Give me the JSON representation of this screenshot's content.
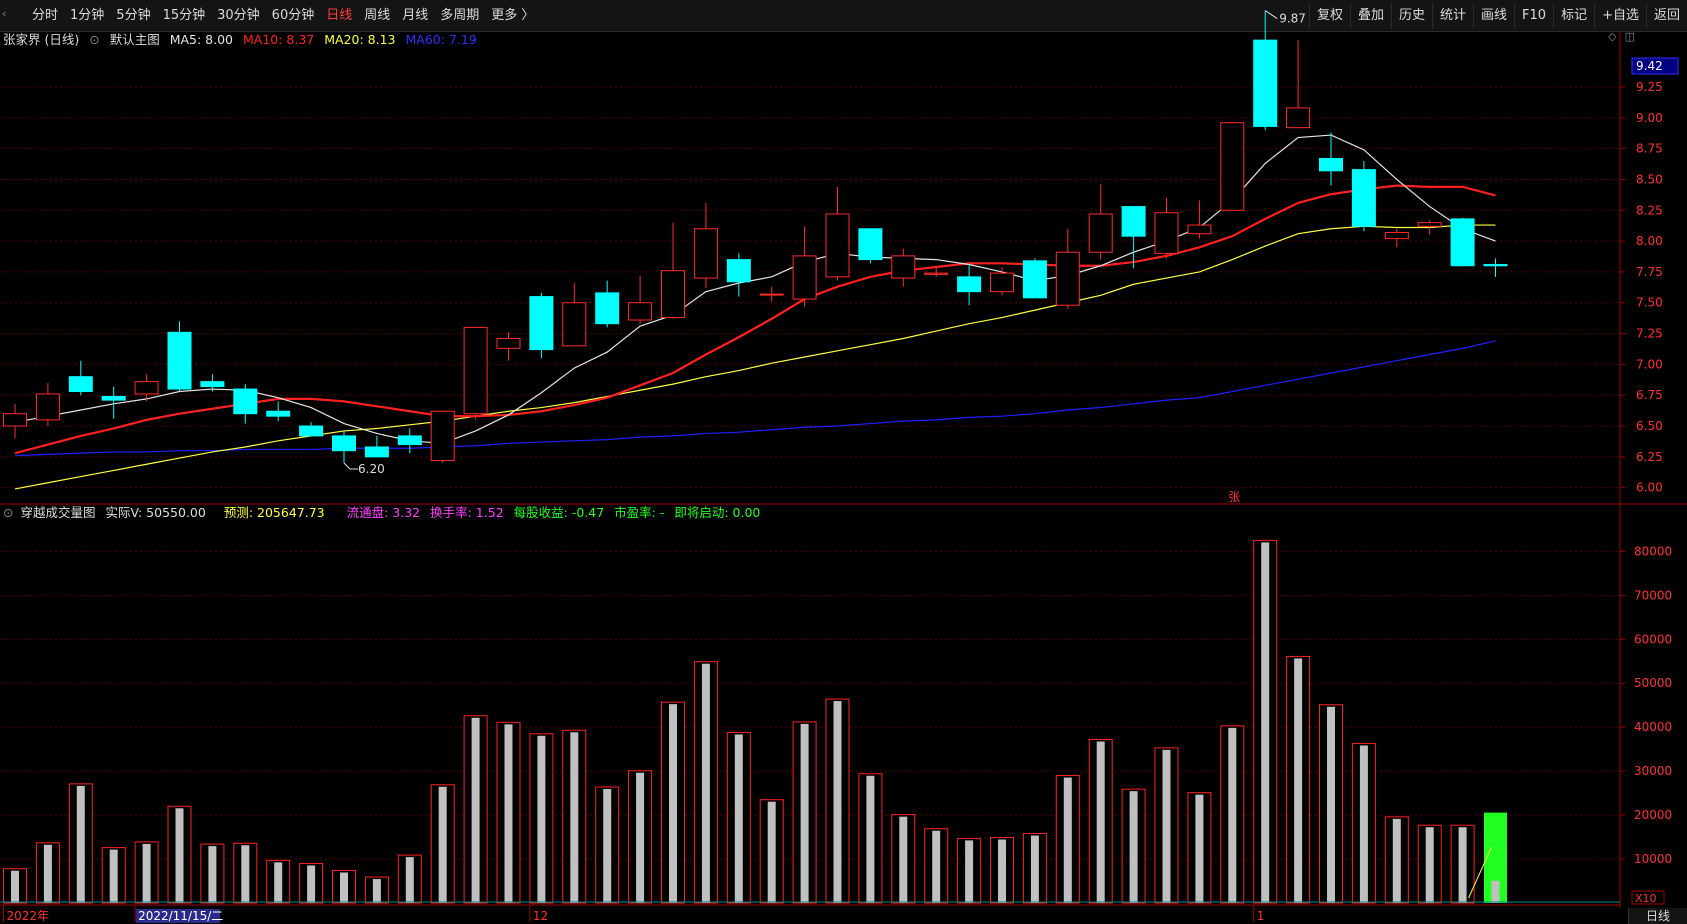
{
  "toolbar": {
    "menu_glyph": "‹",
    "tabs": [
      "分时",
      "1分钟",
      "5分钟",
      "15分钟",
      "30分钟",
      "60分钟",
      "日线",
      "周线",
      "月线",
      "多周期",
      "更多 〉"
    ],
    "active_tab": 6,
    "right_tools": [
      "复权",
      "叠加",
      "历史",
      "统计",
      "画线",
      "F10",
      "标记",
      "+自选",
      "返回"
    ]
  },
  "main_info": {
    "title": "张家界 (日线)",
    "chart_name": "默认主图",
    "ma5": "MA5: 8.00",
    "ma10": "MA10: 8.37",
    "ma20": "MA20: 8.13",
    "ma60": "MA60: 7.19"
  },
  "vol_info": {
    "title": "穿越成交量图",
    "actual": "实际V: 50550.00",
    "forecast": "预测: 205647.73",
    "float": "流通盘: 3.32",
    "turnover": "换手率: 1.52",
    "eps": "每股收益: -0.47",
    "pe": "市盈率: -",
    "launch": "即将启动: 0.00"
  },
  "colors": {
    "up": "#ff2a2a",
    "down": "#00ffff",
    "ma5": "#e6e6e6",
    "ma10": "#ff2020",
    "ma20": "#ffff40",
    "ma60": "#2020ff",
    "grid": "#5a0000",
    "axis_text": "#ff3030"
  },
  "price_axis": [
    "9.25",
    "9.00",
    "8.75",
    "8.50",
    "8.25",
    "8.00",
    "7.75",
    "7.50",
    "7.25",
    "7.00",
    "6.75",
    "6.50",
    "6.25",
    "6.00"
  ],
  "current_price_tag": "9.42",
  "vol_axis": [
    "80000",
    "70000",
    "60000",
    "50000",
    "40000",
    "30000",
    "20000",
    "10000"
  ],
  "vol_unit": "X10",
  "annotations": {
    "high": "9.87",
    "low": "6.20",
    "limit_up_mark": "张"
  },
  "date_labels": [
    {
      "text": "2022年",
      "bar": 0
    },
    {
      "text": "2022/11/15/二",
      "bar": 4
    },
    {
      "text": "12",
      "bar": 16
    },
    {
      "text": "1",
      "bar": 38
    }
  ],
  "period_label": "日线",
  "chart_data": {
    "type": "candlestick",
    "candles": [
      {
        "o": 6.5,
        "h": 6.68,
        "l": 6.4,
        "c": 6.6
      },
      {
        "o": 6.55,
        "h": 6.85,
        "l": 6.5,
        "c": 6.76
      },
      {
        "o": 6.9,
        "h": 7.03,
        "l": 6.75,
        "c": 6.78
      },
      {
        "o": 6.74,
        "h": 6.82,
        "l": 6.56,
        "c": 6.71
      },
      {
        "o": 6.76,
        "h": 6.92,
        "l": 6.7,
        "c": 6.86
      },
      {
        "o": 7.26,
        "h": 7.35,
        "l": 6.78,
        "c": 6.8
      },
      {
        "o": 6.86,
        "h": 6.92,
        "l": 6.78,
        "c": 6.82
      },
      {
        "o": 6.8,
        "h": 6.84,
        "l": 6.52,
        "c": 6.6
      },
      {
        "o": 6.62,
        "h": 6.7,
        "l": 6.54,
        "c": 6.58
      },
      {
        "o": 6.5,
        "h": 6.53,
        "l": 6.42,
        "c": 6.42
      },
      {
        "o": 6.42,
        "h": 6.46,
        "l": 6.2,
        "c": 6.3
      },
      {
        "o": 6.33,
        "h": 6.42,
        "l": 6.25,
        "c": 6.25
      },
      {
        "o": 6.42,
        "h": 6.48,
        "l": 6.28,
        "c": 6.35
      },
      {
        "o": 6.22,
        "h": 6.62,
        "l": 6.2,
        "c": 6.62
      },
      {
        "o": 6.6,
        "h": 7.3,
        "l": 6.55,
        "c": 7.3
      },
      {
        "o": 7.13,
        "h": 7.26,
        "l": 7.03,
        "c": 7.21
      },
      {
        "o": 7.55,
        "h": 7.58,
        "l": 7.05,
        "c": 7.12
      },
      {
        "o": 7.15,
        "h": 7.66,
        "l": 7.15,
        "c": 7.5
      },
      {
        "o": 7.58,
        "h": 7.68,
        "l": 7.3,
        "c": 7.33
      },
      {
        "o": 7.36,
        "h": 7.72,
        "l": 7.33,
        "c": 7.5
      },
      {
        "o": 7.38,
        "h": 8.15,
        "l": 7.37,
        "c": 7.76
      },
      {
        "o": 7.7,
        "h": 8.31,
        "l": 7.62,
        "c": 8.1
      },
      {
        "o": 7.85,
        "h": 7.9,
        "l": 7.55,
        "c": 7.67
      },
      {
        "o": 7.57,
        "h": 7.63,
        "l": 7.51,
        "c": 7.57
      },
      {
        "o": 7.53,
        "h": 8.12,
        "l": 7.47,
        "c": 7.88
      },
      {
        "o": 7.71,
        "h": 8.44,
        "l": 7.68,
        "c": 8.22
      },
      {
        "o": 8.1,
        "h": 8.1,
        "l": 7.82,
        "c": 7.85
      },
      {
        "o": 7.7,
        "h": 7.94,
        "l": 7.63,
        "c": 7.88
      },
      {
        "o": 7.73,
        "h": 7.8,
        "l": 7.71,
        "c": 7.74
      },
      {
        "o": 7.71,
        "h": 7.81,
        "l": 7.48,
        "c": 7.59
      },
      {
        "o": 7.59,
        "h": 7.79,
        "l": 7.56,
        "c": 7.74
      },
      {
        "o": 7.84,
        "h": 7.86,
        "l": 7.54,
        "c": 7.54
      },
      {
        "o": 7.48,
        "h": 8.1,
        "l": 7.45,
        "c": 7.91
      },
      {
        "o": 7.91,
        "h": 8.46,
        "l": 7.85,
        "c": 8.22
      },
      {
        "o": 8.28,
        "h": 8.28,
        "l": 7.78,
        "c": 8.04
      },
      {
        "o": 7.9,
        "h": 8.35,
        "l": 7.86,
        "c": 8.23
      },
      {
        "o": 8.06,
        "h": 8.33,
        "l": 8.02,
        "c": 8.13
      },
      {
        "o": 8.25,
        "h": 8.95,
        "l": 8.25,
        "c": 8.96
      },
      {
        "o": 9.63,
        "h": 9.87,
        "l": 8.9,
        "c": 8.93
      },
      {
        "o": 8.92,
        "h": 9.63,
        "l": 8.92,
        "c": 9.08
      },
      {
        "o": 8.67,
        "h": 8.88,
        "l": 8.45,
        "c": 8.57
      },
      {
        "o": 8.58,
        "h": 8.65,
        "l": 8.08,
        "c": 8.12
      },
      {
        "o": 8.02,
        "h": 8.1,
        "l": 7.95,
        "c": 8.07
      },
      {
        "o": 8.12,
        "h": 8.17,
        "l": 8.05,
        "c": 8.15
      },
      {
        "o": 8.18,
        "h": 8.19,
        "l": 7.8,
        "c": 7.8
      },
      {
        "o": 7.81,
        "h": 7.86,
        "l": 7.71,
        "c": 7.8
      }
    ],
    "ma5": [
      6.53,
      6.58,
      6.63,
      6.68,
      6.72,
      6.78,
      6.8,
      6.79,
      6.73,
      6.65,
      6.52,
      6.44,
      6.38,
      6.36,
      6.46,
      6.59,
      6.77,
      6.97,
      7.1,
      7.31,
      7.4,
      7.59,
      7.66,
      7.71,
      7.83,
      7.9,
      7.87,
      7.86,
      7.85,
      7.81,
      7.75,
      7.68,
      7.72,
      7.8,
      7.91,
      8.0,
      8.11,
      8.33,
      8.63,
      8.84,
      8.86,
      8.74,
      8.5,
      8.28,
      8.1,
      8.0
    ],
    "ma10": [
      6.28,
      6.35,
      6.42,
      6.48,
      6.55,
      6.6,
      6.64,
      6.68,
      6.72,
      6.72,
      6.7,
      6.66,
      6.62,
      6.58,
      6.58,
      6.59,
      6.62,
      6.67,
      6.73,
      6.83,
      6.93,
      7.08,
      7.22,
      7.37,
      7.53,
      7.63,
      7.71,
      7.76,
      7.79,
      7.82,
      7.82,
      7.81,
      7.8,
      7.8,
      7.83,
      7.88,
      7.95,
      8.04,
      8.18,
      8.31,
      8.38,
      8.42,
      8.45,
      8.44,
      8.44,
      8.37
    ],
    "ma20": [
      5.99,
      6.04,
      6.09,
      6.14,
      6.19,
      6.24,
      6.29,
      6.33,
      6.38,
      6.42,
      6.46,
      6.48,
      6.51,
      6.54,
      6.58,
      6.62,
      6.65,
      6.69,
      6.74,
      6.79,
      6.84,
      6.9,
      6.95,
      7.01,
      7.06,
      7.11,
      7.16,
      7.21,
      7.27,
      7.33,
      7.38,
      7.44,
      7.5,
      7.56,
      7.65,
      7.7,
      7.75,
      7.85,
      7.96,
      8.06,
      8.1,
      8.12,
      8.11,
      8.11,
      8.13,
      8.13
    ],
    "ma60": [
      6.26,
      6.27,
      6.28,
      6.29,
      6.29,
      6.3,
      6.3,
      6.31,
      6.31,
      6.31,
      6.32,
      6.32,
      6.32,
      6.33,
      6.34,
      6.36,
      6.37,
      6.38,
      6.39,
      6.41,
      6.42,
      6.44,
      6.45,
      6.47,
      6.49,
      6.5,
      6.52,
      6.54,
      6.55,
      6.57,
      6.58,
      6.6,
      6.63,
      6.65,
      6.68,
      6.71,
      6.73,
      6.78,
      6.83,
      6.88,
      6.93,
      6.98,
      7.03,
      7.08,
      7.13,
      7.19
    ],
    "volume": [
      7800,
      13700,
      27100,
      12600,
      13900,
      22000,
      13400,
      13600,
      9700,
      9000,
      7400,
      5900,
      10900,
      26900,
      42600,
      41100,
      38500,
      39300,
      26400,
      30100,
      45700,
      54900,
      38800,
      23500,
      41200,
      46400,
      29400,
      20100,
      16900,
      14700,
      14900,
      15800,
      29000,
      37200,
      25900,
      35300,
      25100,
      40300,
      82500,
      56100,
      45100,
      36300,
      19600,
      17700,
      17700,
      5055
    ],
    "forecast_volume": 20565,
    "price_range": [
      5.9,
      9.55
    ],
    "vol_range": [
      0,
      86000
    ]
  }
}
